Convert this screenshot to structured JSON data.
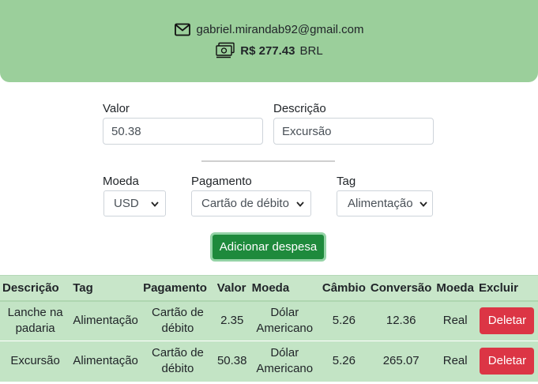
{
  "header": {
    "email": "gabriel.mirandab92@gmail.com",
    "total_value": "R$ 277.43",
    "currency": "BRL"
  },
  "form": {
    "valor_label": "Valor",
    "valor_value": "50.38",
    "descricao_label": "Descrição",
    "descricao_value": "Excursão",
    "moeda_label": "Moeda",
    "moeda_value": "USD",
    "pagamento_label": "Pagamento",
    "pagamento_value": "Cartão de débito",
    "tag_label": "Tag",
    "tag_value": "Alimentação",
    "add_button": "Adicionar despesa"
  },
  "table": {
    "headers": [
      "Descrição",
      "Tag",
      "Pagamento",
      "Valor",
      "Moeda",
      "Câmbio",
      "Conversão",
      "Moeda",
      "Excluir"
    ],
    "rows": [
      {
        "descricao": "Lanche na padaria",
        "tag": "Alimentação",
        "pagamento": "Cartão de débito",
        "valor": "2.35",
        "moeda": "Dólar Americano",
        "cambio": "5.26",
        "conversao": "12.36",
        "moeda_conversao": "Real",
        "excluir": "Deletar"
      },
      {
        "descricao": "Excursão",
        "tag": "Alimentação",
        "pagamento": "Cartão de débito",
        "valor": "50.38",
        "moeda": "Dólar Americano",
        "cambio": "5.26",
        "conversao": "265.07",
        "moeda_conversao": "Real",
        "excluir": "Deletar"
      }
    ]
  },
  "icons": {
    "email": "envelope-icon",
    "money": "money-bills-icon",
    "chevron": "chevron-down-icon"
  },
  "colors": {
    "header_bg": "#9bcf9b",
    "add_button": "#1e8a3c",
    "delete_button": "#dc3545",
    "table_bg": "#c3e4c5"
  }
}
